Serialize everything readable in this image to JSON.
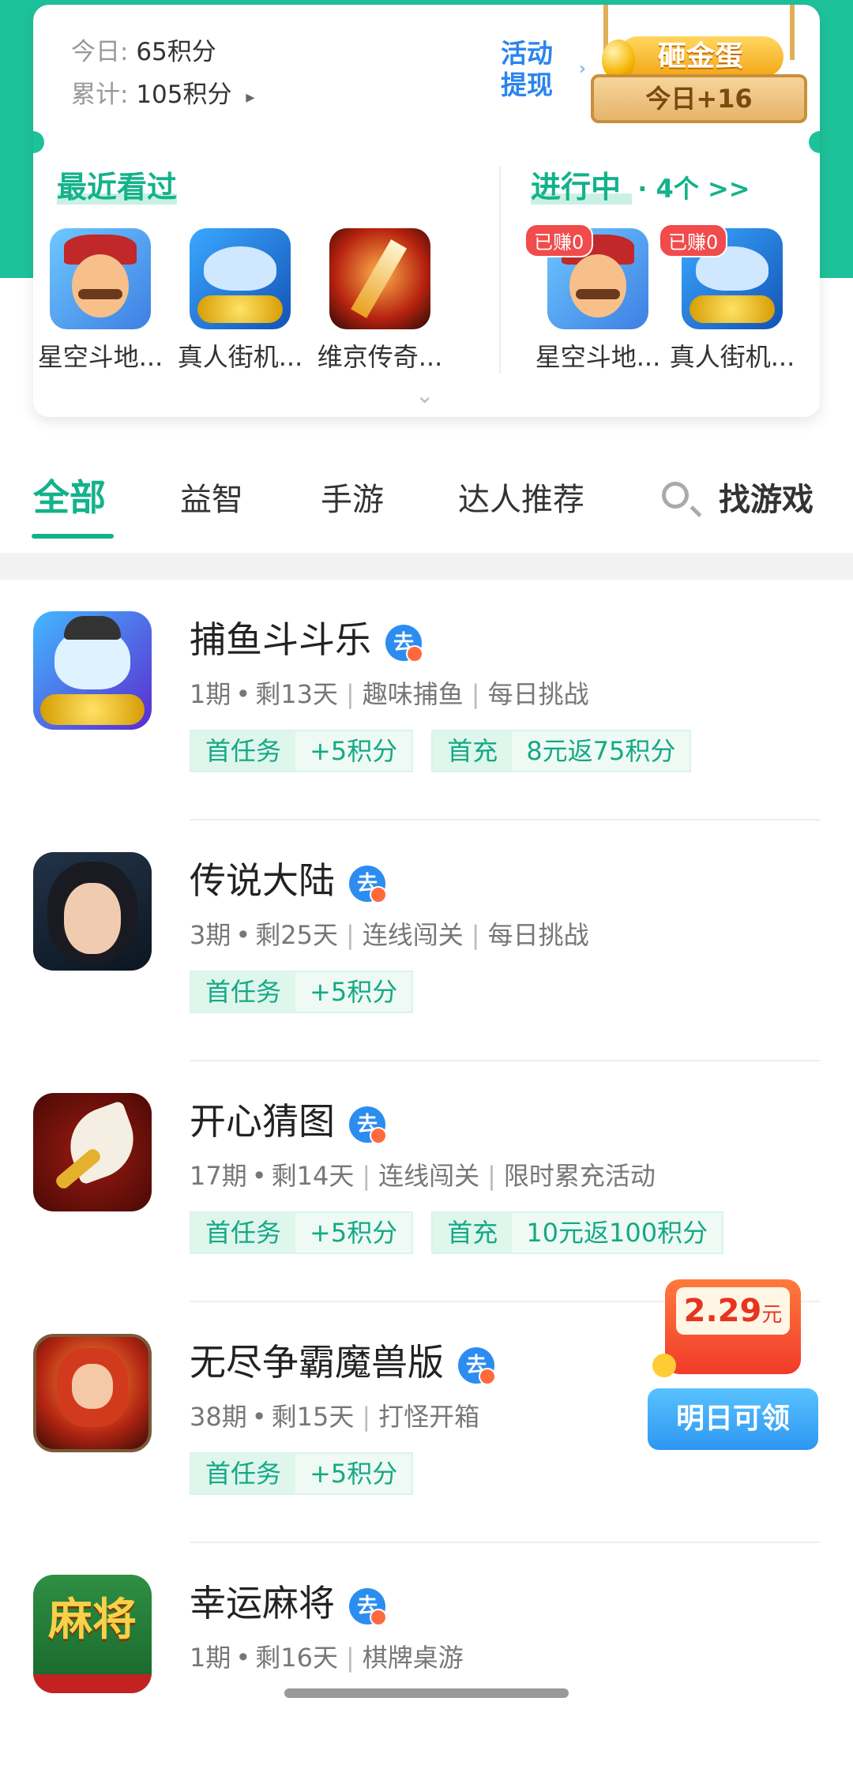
{
  "header": {
    "today_label": "今日:",
    "today_value": "65积分",
    "total_label": "累计:",
    "total_value": "105积分",
    "total_chevron": "▸",
    "withdraw_line1": "活动",
    "withdraw_line2": "提现",
    "withdraw_arrow": "›",
    "egg_title": "砸金蛋",
    "egg_today": "今日+16"
  },
  "recent": {
    "title": "最近看过",
    "games": [
      {
        "name": "星空斗地..."
      },
      {
        "name": "真人街机..."
      },
      {
        "name": "维京传奇..."
      }
    ]
  },
  "ongoing": {
    "title": "进行中",
    "count": "· 4个 >>",
    "games": [
      {
        "name": "星空斗地...",
        "earned": "已赚0"
      },
      {
        "name": "真人街机...",
        "earned": "已赚0"
      }
    ]
  },
  "expand_icon": "⌄",
  "tabs": {
    "items": [
      {
        "label": "全部"
      },
      {
        "label": "益智"
      },
      {
        "label": "手游"
      },
      {
        "label": "达人推荐"
      }
    ],
    "search_label": "找游戏"
  },
  "list": [
    {
      "name": "捕鱼斗斗乐",
      "period": "1期",
      "remaining": "剩13天",
      "tags_text": [
        "趣味捕鱼",
        "每日挑战"
      ],
      "rewards": [
        {
          "k": "首任务",
          "v": "+5积分"
        },
        {
          "k": "首充",
          "v": "8元返75积分"
        }
      ]
    },
    {
      "name": "传说大陆",
      "period": "3期",
      "remaining": "剩25天",
      "tags_text": [
        "连线闯关",
        "每日挑战"
      ],
      "rewards": [
        {
          "k": "首任务",
          "v": "+5积分"
        }
      ]
    },
    {
      "name": "开心猜图",
      "period": "17期",
      "remaining": "剩14天",
      "tags_text": [
        "连线闯关",
        "限时累充活动"
      ],
      "rewards": [
        {
          "k": "首任务",
          "v": "+5积分"
        },
        {
          "k": "首充",
          "v": "10元返100积分"
        }
      ]
    },
    {
      "name": "无尽争霸魔兽版",
      "period": "38期",
      "remaining": "剩15天",
      "tags_text": [
        "打怪开箱"
      ],
      "rewards": [
        {
          "k": "首任务",
          "v": "+5积分"
        }
      ]
    },
    {
      "name": "幸运麻将",
      "period": "1期",
      "remaining": "剩16天",
      "tags_text": [
        "棋牌桌游"
      ],
      "rewards": []
    }
  ],
  "badge_glyph": "去",
  "mahjong_icon_text": "麻将",
  "redpacket": {
    "amount": "2.29",
    "unit": "元",
    "button": "明日可领"
  },
  "colors": {
    "brand_green": "#1ec29a",
    "accent_text": "#13b28b",
    "tag_bg": "#effaf5",
    "earned_red": "#f14b4b",
    "button_blue": "#2d97f2"
  }
}
